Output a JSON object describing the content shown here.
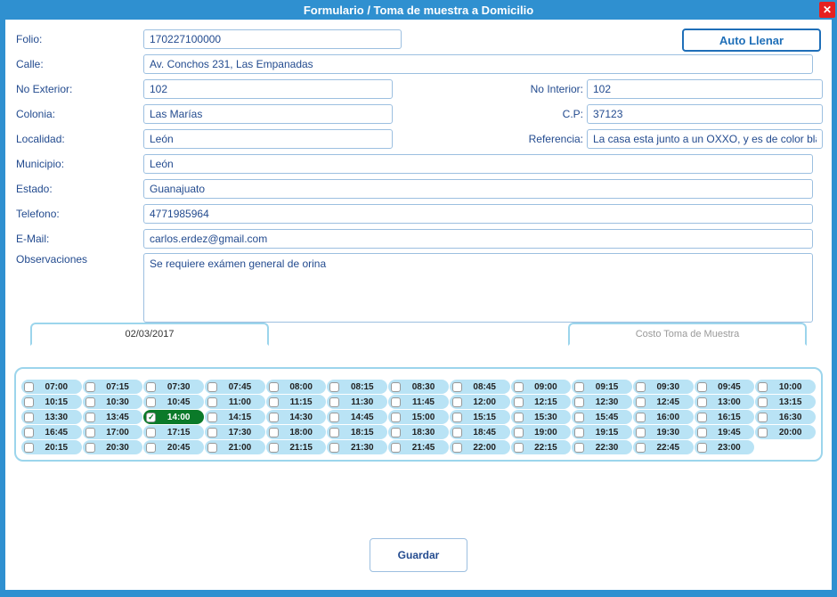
{
  "window": {
    "title": "Formulario / Toma de muestra a Domicilio",
    "close_icon": "✕"
  },
  "buttons": {
    "auto_llenar": "Auto Llenar",
    "guardar": "Guardar"
  },
  "labels": {
    "folio": "Folio:",
    "calle": "Calle:",
    "no_exterior": "No Exterior:",
    "no_interior": "No Interior:",
    "colonia": "Colonia:",
    "cp": "C.P:",
    "localidad": "Localidad:",
    "referencia": "Referencia:",
    "municipio": "Municipio:",
    "estado": "Estado:",
    "telefono": "Telefono:",
    "email": "E-Mail:",
    "observaciones": "Observaciones"
  },
  "values": {
    "folio": "170227100000",
    "calle": "Av. Conchos 231, Las Empanadas",
    "no_exterior": "102",
    "no_interior": "102",
    "colonia": "Las Marías",
    "cp": "37123",
    "localidad": "León",
    "referencia": "La casa esta junto a un OXXO, y es de color blanco",
    "municipio": "León",
    "estado": "Guanajuato",
    "telefono": "4771985964",
    "email": "carlos.erdez@gmail.com",
    "observaciones": "Se requiere exámen general de orina"
  },
  "schedule": {
    "date_tab": "02/03/2017",
    "cost_tab": "Costo Toma de Muestra",
    "selected": "14:00",
    "slots": [
      "07:00",
      "07:15",
      "07:30",
      "07:45",
      "08:00",
      "08:15",
      "08:30",
      "08:45",
      "09:00",
      "09:15",
      "09:30",
      "09:45",
      "10:00",
      "10:15",
      "10:30",
      "10:45",
      "11:00",
      "11:15",
      "11:30",
      "11:45",
      "12:00",
      "12:15",
      "12:30",
      "12:45",
      "13:00",
      "13:15",
      "13:30",
      "13:45",
      "14:00",
      "14:15",
      "14:30",
      "14:45",
      "15:00",
      "15:15",
      "15:30",
      "15:45",
      "16:00",
      "16:15",
      "16:30",
      "16:45",
      "17:00",
      "17:15",
      "17:30",
      "18:00",
      "18:15",
      "18:30",
      "18:45",
      "19:00",
      "19:15",
      "19:30",
      "19:45",
      "20:00",
      "20:15",
      "20:30",
      "20:45",
      "21:00",
      "21:15",
      "21:30",
      "21:45",
      "22:00",
      "22:15",
      "22:30",
      "22:45",
      "23:00"
    ]
  }
}
